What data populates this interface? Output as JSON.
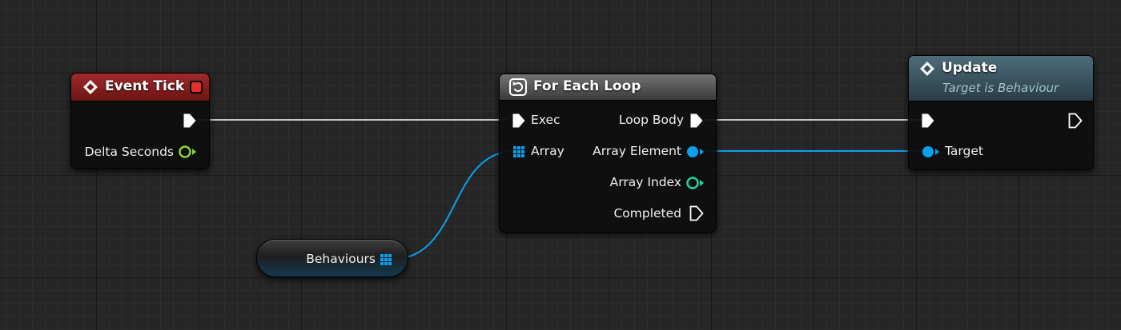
{
  "graph": {
    "nodes": {
      "event_tick": {
        "title": "Event Tick",
        "outputs": {
          "delta_seconds": "Delta Seconds"
        }
      },
      "for_each_loop": {
        "title": "For Each Loop",
        "inputs": {
          "exec": "Exec",
          "array": "Array"
        },
        "outputs": {
          "loop_body": "Loop Body",
          "array_element": "Array Element",
          "array_index": "Array Index",
          "completed": "Completed"
        }
      },
      "update": {
        "title": "Update",
        "subtitle": "Target is Behaviour",
        "inputs": {
          "target": "Target"
        }
      },
      "behaviours": {
        "label": "Behaviours"
      }
    }
  },
  "colors": {
    "exec_wire": "#c8c8c8",
    "object_pin": "#0aa0f0",
    "float_pin": "#8fd13b",
    "int_pin": "#1fd6a0",
    "event_header": "#7a1515",
    "delegate_red": "#e53030"
  },
  "icons": {
    "event_node": "diamond-event-icon",
    "loop_node": "loop-macro-icon",
    "function_node": "diamond-function-icon"
  }
}
